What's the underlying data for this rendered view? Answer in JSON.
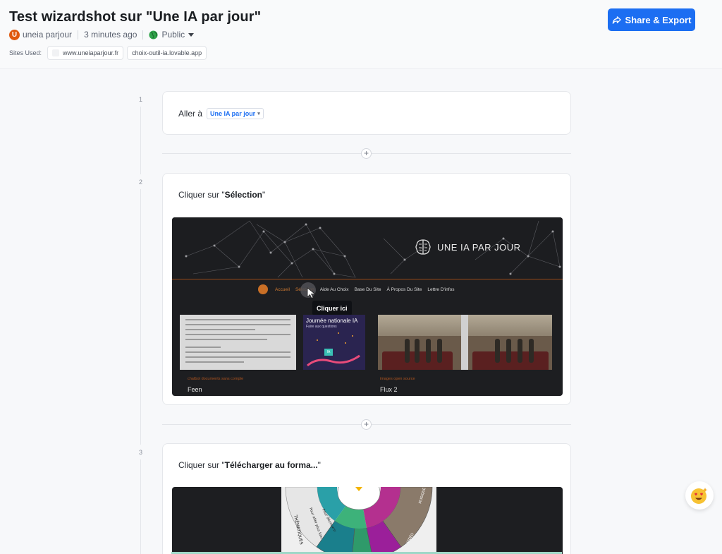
{
  "header": {
    "title": "Test wizardshot sur \"Une IA par jour\"",
    "author_initial": "U",
    "author": "uneia parjour",
    "time_ago": "3 minutes ago",
    "visibility": "Public",
    "sites_label": "Sites Used:",
    "sites": [
      "www.uneiaparjour.fr",
      "choix-outil-ia.lovable.app"
    ],
    "share_button": "Share & Export"
  },
  "steps": [
    {
      "number": "1",
      "prefix": "Aller à",
      "link": "Une IA par jour"
    },
    {
      "number": "2",
      "prefix": "Cliquer sur \"",
      "bold": "Sélection",
      "suffix": "\"",
      "screenshot": {
        "brand": "UNE IA PAR JOUR",
        "nav": [
          "Accueil",
          "Sélection",
          "Aide Au Choix",
          "Base Du Site",
          "À Propos Du Site",
          "Lettre D'infos"
        ],
        "tooltip": "Cliquer ici",
        "thumb_title": "Journée nationale IA",
        "thumb_subtitle": "Faire aux questions",
        "thumb_badge": "IA",
        "posts": [
          {
            "tags": "chatbot  documents  sans compte",
            "title": "Feen"
          },
          {
            "tags": "images  open source",
            "title": "Flux 2"
          }
        ]
      }
    },
    {
      "number": "3",
      "prefix": "Cliquer sur \"",
      "bold": "Télécharger au forma...",
      "suffix": "\"",
      "screenshot": {
        "wheel_labels": [
          "THÉMATIQUES",
          "Pour aller plus loin",
          "Pour découvrir",
          "MUSIQUE",
          "VIDÉO"
        ]
      }
    }
  ],
  "colors": {
    "accent": "#1c6ef2",
    "site_orange": "#c96f26"
  },
  "icons": [
    "share-icon",
    "globe-icon",
    "plus-icon",
    "cursor-icon",
    "emoji-heart-eyes-icon"
  ]
}
